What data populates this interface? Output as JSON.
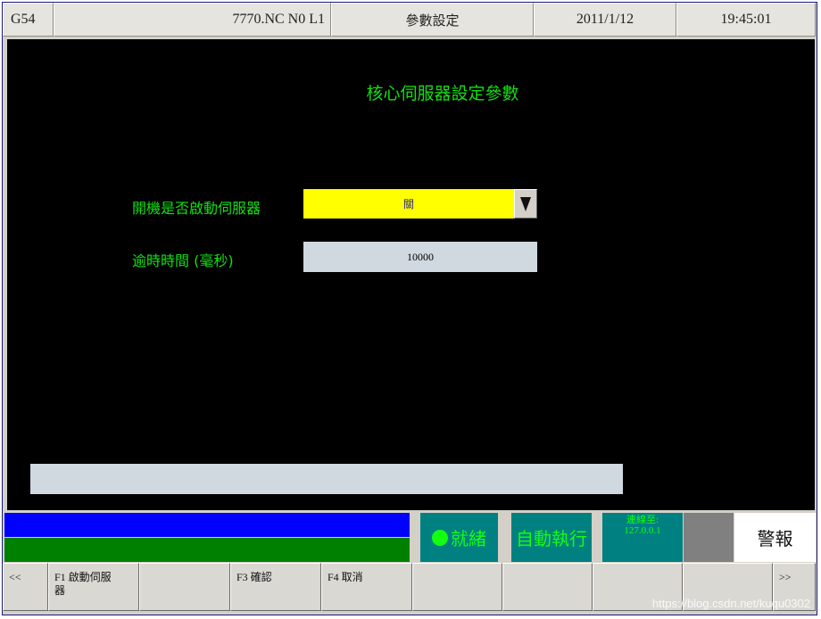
{
  "topbar": {
    "coord": "G54",
    "program": "7770.NC N0 L1",
    "screen": "參數設定",
    "date": "2011/1/12",
    "time": "19:45:01"
  },
  "main": {
    "title": "核心伺服器設定參數",
    "fields": [
      {
        "label": "開機是否啟動伺服器",
        "value": "關",
        "type": "select"
      },
      {
        "label": "逾時時間 (毫秒)",
        "value": "10000",
        "type": "text"
      }
    ],
    "message": ""
  },
  "status": {
    "ready": "就緒",
    "mode": "自動執行",
    "connection_line1": "連線至:",
    "connection_line2": "127.0.0.1",
    "alarm": "警報"
  },
  "fkeys": [
    {
      "label": "<<"
    },
    {
      "label": "F1 啟動伺服器"
    },
    {
      "label": ""
    },
    {
      "label": "F3 確認"
    },
    {
      "label": "F4 取消"
    },
    {
      "label": ""
    },
    {
      "label": ""
    },
    {
      "label": ""
    },
    {
      "label": ""
    },
    {
      "label": ">>"
    }
  ],
  "watermark": "https://blog.csdn.net/kuqu0302",
  "colors": {
    "green_text": "#12e012",
    "select_bg": "#ffff00",
    "status_blue": "#0000ff",
    "status_green": "#008000",
    "teal": "#008080"
  }
}
